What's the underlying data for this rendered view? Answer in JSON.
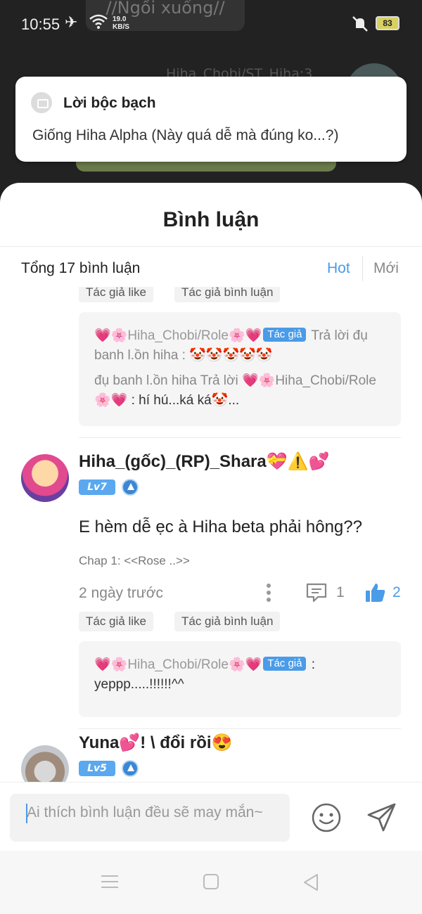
{
  "status_bar": {
    "time": "10:55",
    "speed_value": "19.0",
    "speed_unit": "KB/S",
    "battery": "83"
  },
  "background": {
    "chip_text": "//Ngồi xuống//",
    "user_text": "Hiha_Chobi/ST_Hiha:3"
  },
  "notification": {
    "title": "Lời bộc bạch",
    "body": "Giống Hiha Alpha (Này quá dễ mà đúng ko...?)"
  },
  "sheet": {
    "title": "Bình luận",
    "total": "Tổng 17 bình luận",
    "tabs": {
      "hot": "Hot",
      "new": "Mới"
    }
  },
  "partial_comment": {
    "tags": [
      "Tác giả like",
      "Tác giả bình luận"
    ],
    "replies": [
      {
        "author": "💗🌸Hiha_Chobi/Role🌸💗",
        "badge": "Tác giả",
        "verb": " Trả lời đụ banh l.ồn hiha : ",
        "text": "🤡🤡🤡🤡🤡"
      },
      {
        "author_prefix": "đụ banh l.ồn hiha",
        "verb": " Trả lời ",
        "target": "💗🌸Hiha_Chobi/Role🌸💗",
        "text": " : hí hú...ká ká🤡..."
      }
    ]
  },
  "comments": [
    {
      "name": "Hiha_(gốc)_(RP)_Shara💝⚠️💕",
      "level": "Lv7",
      "text": "E hèm dễ ẹc à Hiha beta phải hông??",
      "chapter": "Chap 1: <<Rose ..>>",
      "time": "2 ngày trước",
      "reply_count": "1",
      "like_count": "2",
      "tags": [
        "Tác giả like",
        "Tác giả bình luận"
      ],
      "reply": {
        "author": "💗🌸Hiha_Chobi/Role🌸💗",
        "badge": "Tác giả",
        "text": " : yeppp.....!!!!!!^^"
      }
    },
    {
      "name": "Yuna💕! \\ đổi rồi😍",
      "level": "Lv5"
    }
  ],
  "input": {
    "placeholder": "Ai thích bình luận đều sẽ may mắn~"
  },
  "colors": {
    "accent": "#4a9be8",
    "level_badge": "#5aa8f0",
    "background": "#ffffff"
  }
}
